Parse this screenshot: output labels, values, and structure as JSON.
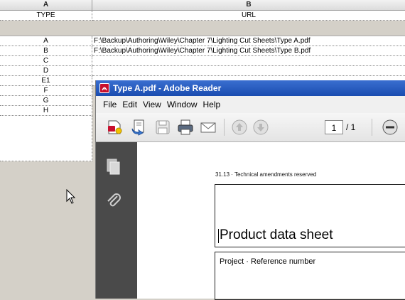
{
  "sheet": {
    "col_headers": [
      "A",
      "B"
    ],
    "header_row": {
      "a": "TYPE",
      "b": "URL"
    },
    "rows": [
      {
        "a": "A",
        "b": "F:\\Backup\\Authoring\\Wiley\\Chapter 7\\Lighting Cut Sheets\\Type A.pdf"
      },
      {
        "a": "B",
        "b": "F:\\Backup\\Authoring\\Wiley\\Chapter 7\\Lighting Cut Sheets\\Type B.pdf"
      },
      {
        "a": "C",
        "b": ""
      },
      {
        "a": "D",
        "b": ""
      },
      {
        "a": "E1",
        "b": ""
      },
      {
        "a": "F",
        "b": ""
      },
      {
        "a": "G",
        "b": ""
      },
      {
        "a": "H",
        "b": ""
      }
    ]
  },
  "reader": {
    "title": "Type A.pdf - Adobe Reader",
    "menu": [
      "File",
      "Edit",
      "View",
      "Window",
      "Help"
    ],
    "toolbar": {
      "icons": [
        "create-pdf-icon",
        "open-icon",
        "save-icon",
        "print-icon",
        "email-icon",
        "previous-page-icon",
        "next-page-icon",
        "zoom-out-icon"
      ],
      "current_page": "1",
      "total_pages": "/ 1"
    },
    "left_panel": [
      "pages-icon",
      "attachments-icon"
    ],
    "document": {
      "header": "31.13 · Technical amendments reserved",
      "title": "Product data sheet",
      "field_label": "Project · Reference number"
    }
  },
  "colors": {
    "title_bar": "#1a4cb0",
    "panel_dark": "#4a4a4a",
    "pdf_red": "#c8102e"
  }
}
